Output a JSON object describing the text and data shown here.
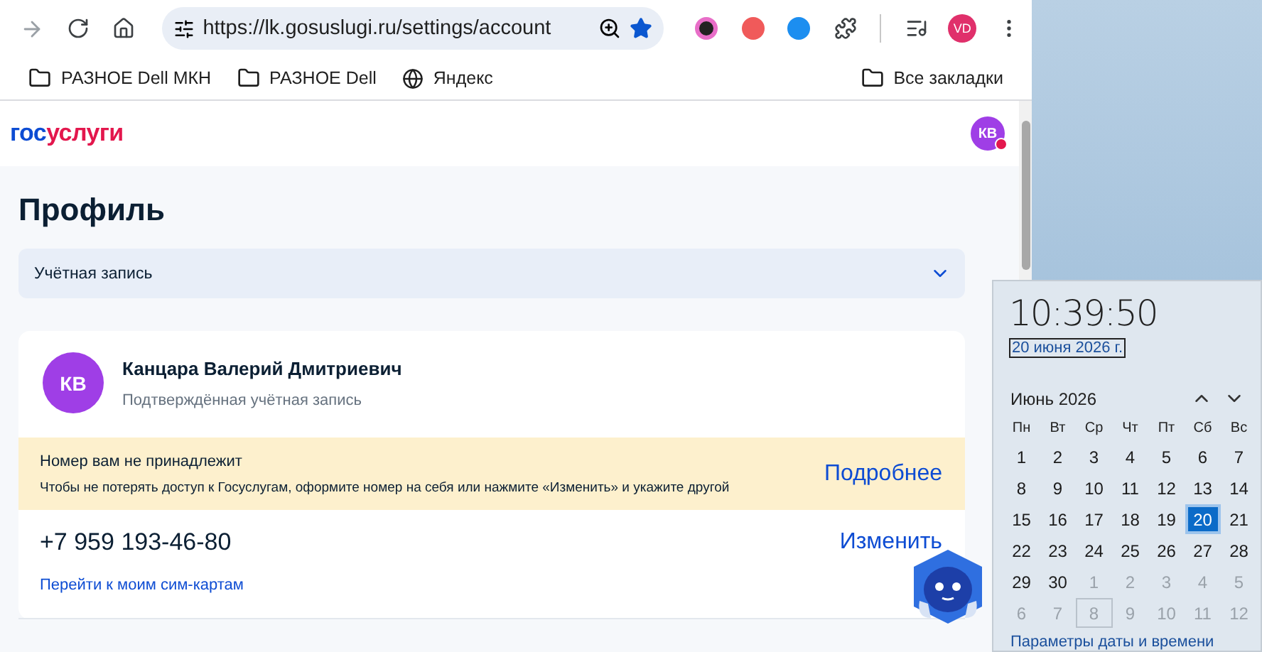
{
  "browser": {
    "url": "https://lk.gosuslugi.ru/settings/account",
    "profile_initials": "VD",
    "bookmarks": [
      {
        "label": "РАЗНОЕ Dell МКН",
        "kind": "folder"
      },
      {
        "label": "РАЗНОЕ Dell",
        "kind": "folder"
      },
      {
        "label": "Яндекс",
        "kind": "site"
      }
    ],
    "all_bookmarks": "Все закладки"
  },
  "site": {
    "logo_part_1": "гос",
    "logo_part_2": "услуги",
    "user_initials": "КВ",
    "has_notification": true
  },
  "page_title": "Профиль",
  "section_select": {
    "value": "Учётная запись",
    "expanded": false
  },
  "profile": {
    "initials": "КВ",
    "name": "Канцара Валерий Дмитриевич",
    "status": "Подтверждённая учётная запись"
  },
  "warning": {
    "title": "Номер вам не принадлежит",
    "text": "Чтобы не потерять доступ к Госуслугам, оформите номер на себя или нажмите «Изменить» и укажите другой",
    "link": "Подробнее"
  },
  "phone": {
    "number": "+7 959 193-46-80",
    "change": "Изменить",
    "sim_link": "Перейти к моим сим-картам"
  },
  "calendar": {
    "time": "10:39:50",
    "date": "20 июня 2026 г.",
    "month": "Июнь 2026",
    "weekdays": [
      "Пн",
      "Вт",
      "Ср",
      "Чт",
      "Пт",
      "Сб",
      "Вс"
    ],
    "weeks": [
      [
        {
          "label": "1",
          "in_month": true,
          "selected": false,
          "outlined": false
        },
        {
          "label": "2",
          "in_month": true,
          "selected": false,
          "outlined": false
        },
        {
          "label": "3",
          "in_month": true,
          "selected": false,
          "outlined": false
        },
        {
          "label": "4",
          "in_month": true,
          "selected": false,
          "outlined": false
        },
        {
          "label": "5",
          "in_month": true,
          "selected": false,
          "outlined": false
        },
        {
          "label": "6",
          "in_month": true,
          "selected": false,
          "outlined": false
        },
        {
          "label": "7",
          "in_month": true,
          "selected": false,
          "outlined": false
        }
      ],
      [
        {
          "label": "8",
          "in_month": true,
          "selected": false,
          "outlined": false
        },
        {
          "label": "9",
          "in_month": true,
          "selected": false,
          "outlined": false
        },
        {
          "label": "10",
          "in_month": true,
          "selected": false,
          "outlined": false
        },
        {
          "label": "11",
          "in_month": true,
          "selected": false,
          "outlined": false
        },
        {
          "label": "12",
          "in_month": true,
          "selected": false,
          "outlined": false
        },
        {
          "label": "13",
          "in_month": true,
          "selected": false,
          "outlined": false
        },
        {
          "label": "14",
          "in_month": true,
          "selected": false,
          "outlined": false
        }
      ],
      [
        {
          "label": "15",
          "in_month": true,
          "selected": false,
          "outlined": false
        },
        {
          "label": "16",
          "in_month": true,
          "selected": false,
          "outlined": false
        },
        {
          "label": "17",
          "in_month": true,
          "selected": false,
          "outlined": false
        },
        {
          "label": "18",
          "in_month": true,
          "selected": false,
          "outlined": false
        },
        {
          "label": "19",
          "in_month": true,
          "selected": false,
          "outlined": false
        },
        {
          "label": "20",
          "in_month": true,
          "selected": true,
          "outlined": false
        },
        {
          "label": "21",
          "in_month": true,
          "selected": false,
          "outlined": false
        }
      ],
      [
        {
          "label": "22",
          "in_month": true,
          "selected": false,
          "outlined": false
        },
        {
          "label": "23",
          "in_month": true,
          "selected": false,
          "outlined": false
        },
        {
          "label": "24",
          "in_month": true,
          "selected": false,
          "outlined": false
        },
        {
          "label": "25",
          "in_month": true,
          "selected": false,
          "outlined": false
        },
        {
          "label": "26",
          "in_month": true,
          "selected": false,
          "outlined": false
        },
        {
          "label": "27",
          "in_month": true,
          "selected": false,
          "outlined": false
        },
        {
          "label": "28",
          "in_month": true,
          "selected": false,
          "outlined": false
        }
      ],
      [
        {
          "label": "29",
          "in_month": true,
          "selected": false,
          "outlined": false
        },
        {
          "label": "30",
          "in_month": true,
          "selected": false,
          "outlined": false
        },
        {
          "label": "1",
          "in_month": false,
          "selected": false,
          "outlined": false
        },
        {
          "label": "2",
          "in_month": false,
          "selected": false,
          "outlined": false
        },
        {
          "label": "3",
          "in_month": false,
          "selected": false,
          "outlined": false
        },
        {
          "label": "4",
          "in_month": false,
          "selected": false,
          "outlined": false
        },
        {
          "label": "5",
          "in_month": false,
          "selected": false,
          "outlined": false
        }
      ],
      [
        {
          "label": "6",
          "in_month": false,
          "selected": false,
          "outlined": false
        },
        {
          "label": "7",
          "in_month": false,
          "selected": false,
          "outlined": false
        },
        {
          "label": "8",
          "in_month": false,
          "selected": false,
          "outlined": true
        },
        {
          "label": "9",
          "in_month": false,
          "selected": false,
          "outlined": false
        },
        {
          "label": "10",
          "in_month": false,
          "selected": false,
          "outlined": false
        },
        {
          "label": "11",
          "in_month": false,
          "selected": false,
          "outlined": false
        },
        {
          "label": "12",
          "in_month": false,
          "selected": false,
          "outlined": false
        }
      ]
    ],
    "settings_link": "Параметры даты и времени"
  }
}
